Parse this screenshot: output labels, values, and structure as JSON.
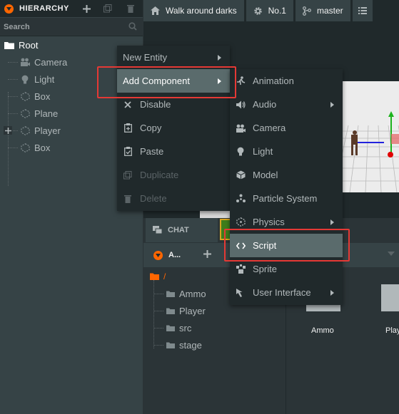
{
  "hierarchy": {
    "title": "HIERARCHY",
    "search_placeholder": "Search",
    "root": {
      "label": "Root"
    },
    "items": [
      {
        "label": "Camera",
        "icon": "camera-icon"
      },
      {
        "label": "Light",
        "icon": "lightbulb-icon"
      },
      {
        "label": "Box",
        "icon": "entity-icon"
      },
      {
        "label": "Plane",
        "icon": "entity-icon"
      },
      {
        "label": "Player",
        "icon": "entity-icon",
        "expandable": true
      },
      {
        "label": "Box",
        "icon": "entity-icon"
      }
    ]
  },
  "topbar": {
    "project": "Walk around darks",
    "settings": "No.1",
    "branch": "master"
  },
  "chat": {
    "label": "CHAT"
  },
  "assets": {
    "title": "A...",
    "root_folder": "/",
    "folders": [
      "Ammo",
      "Player",
      "src",
      "stage"
    ],
    "grid_labels": [
      "Ammo",
      "Play"
    ]
  },
  "context_menu": {
    "items": [
      {
        "label": "New Entity",
        "icon": "",
        "submenu": true,
        "disabled": false
      },
      {
        "label": "Add Component",
        "icon": "",
        "submenu": true,
        "highlighted": true,
        "disabled": false
      },
      {
        "label": "Disable",
        "icon": "close-icon",
        "disabled": false
      },
      {
        "label": "Copy",
        "icon": "copy-icon",
        "disabled": false
      },
      {
        "label": "Paste",
        "icon": "paste-icon",
        "disabled": false
      },
      {
        "label": "Duplicate",
        "icon": "duplicate-icon",
        "disabled": true
      },
      {
        "label": "Delete",
        "icon": "trash-icon",
        "disabled": true
      }
    ]
  },
  "component_menu": {
    "items": [
      {
        "label": "Animation",
        "icon": "animation-icon"
      },
      {
        "label": "Audio",
        "icon": "audio-icon",
        "submenu": true
      },
      {
        "label": "Camera",
        "icon": "camera-icon"
      },
      {
        "label": "Light",
        "icon": "lightbulb-icon"
      },
      {
        "label": "Model",
        "icon": "cube-icon"
      },
      {
        "label": "Particle System",
        "icon": "particles-icon"
      },
      {
        "label": "Physics",
        "icon": "physics-icon",
        "submenu": true
      },
      {
        "label": "Script",
        "icon": "code-icon",
        "highlighted": true
      },
      {
        "label": "Sprite",
        "icon": "sprite-icon"
      },
      {
        "label": "User Interface",
        "icon": "cursor-icon",
        "submenu": true
      }
    ]
  },
  "colors": {
    "accent": "#ff6600",
    "panel": "#364346",
    "dark": "#20292b",
    "highlight": "#5a6b6c",
    "annotation": "#e53935"
  }
}
